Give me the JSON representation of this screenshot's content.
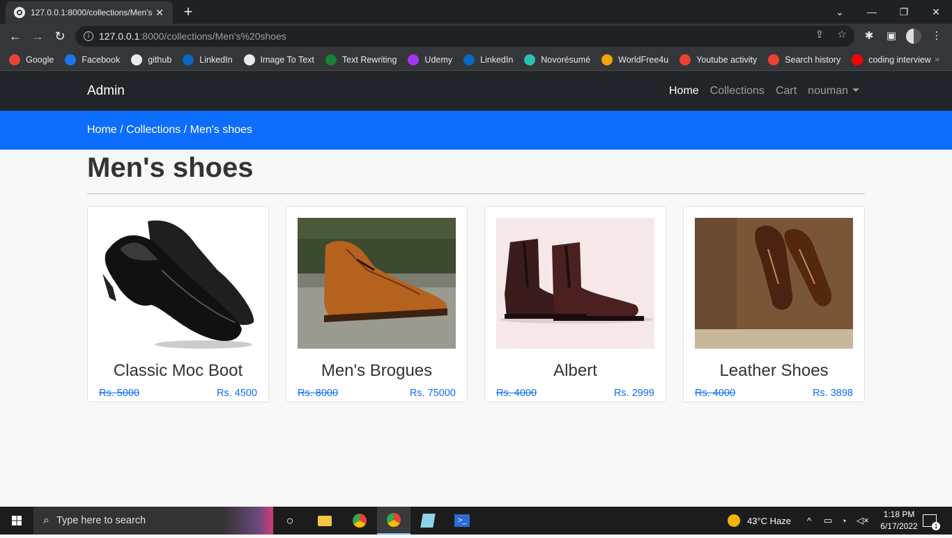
{
  "browser": {
    "tab_title": "127.0.0.1:8000/collections/Men's",
    "url_host": "127.0.0.1",
    "url_path": ":8000/collections/Men's%20shoes",
    "bookmarks": [
      {
        "label": "Google",
        "icon": "google-icon",
        "color": "#ea4335"
      },
      {
        "label": "Facebook",
        "icon": "facebook-icon",
        "color": "#1877f2"
      },
      {
        "label": "github",
        "icon": "github-icon",
        "color": "#e8eaed"
      },
      {
        "label": "LinkedIn",
        "icon": "linkedin-icon",
        "color": "#0a66c2"
      },
      {
        "label": "Image To Text",
        "icon": "sst-icon",
        "color": "#e8eaed"
      },
      {
        "label": "Text Rewriting",
        "icon": "rewriting-icon",
        "color": "#1a7f37"
      },
      {
        "label": "Udemy",
        "icon": "udemy-icon",
        "color": "#a435f0"
      },
      {
        "label": "LinkedIn",
        "icon": "linkedin-icon",
        "color": "#0a66c2"
      },
      {
        "label": "Novorésumé",
        "icon": "novoresume-icon",
        "color": "#27c2b0"
      },
      {
        "label": "WorldFree4u",
        "icon": "worldfree4u-icon",
        "color": "#f0a500"
      },
      {
        "label": "Youtube activity",
        "icon": "google-icon",
        "color": "#ea4335"
      },
      {
        "label": "Search history",
        "icon": "google-icon",
        "color": "#ea4335"
      },
      {
        "label": "coding interview",
        "icon": "youtube-icon",
        "color": "#ff0000"
      }
    ],
    "more": "»"
  },
  "navbar": {
    "brand": "Admin",
    "links": {
      "home": "Home",
      "collections": "Collections",
      "cart": "Cart",
      "user": "nouman"
    }
  },
  "breadcrumb": "Home / Collections / Men's shoes",
  "page": {
    "title": "Men's shoes",
    "accent": "#0d6efd",
    "products": [
      {
        "name": "Classic Moc Boot",
        "original_price": "Rs. 5000",
        "selling_price": "Rs. 4500"
      },
      {
        "name": "Men's Brogues",
        "original_price": "Rs. 8000",
        "selling_price": "Rs. 75000"
      },
      {
        "name": "Albert",
        "original_price": "Rs. 4000",
        "selling_price": "Rs. 2999"
      },
      {
        "name": "Leather Shoes",
        "original_price": "Rs. 4000",
        "selling_price": "Rs. 3898"
      }
    ]
  },
  "taskbar": {
    "search_placeholder": "Type here to search",
    "weather": "43°C  Haze",
    "time": "1:18 PM",
    "date": "6/17/2022",
    "notification_count": "1"
  }
}
